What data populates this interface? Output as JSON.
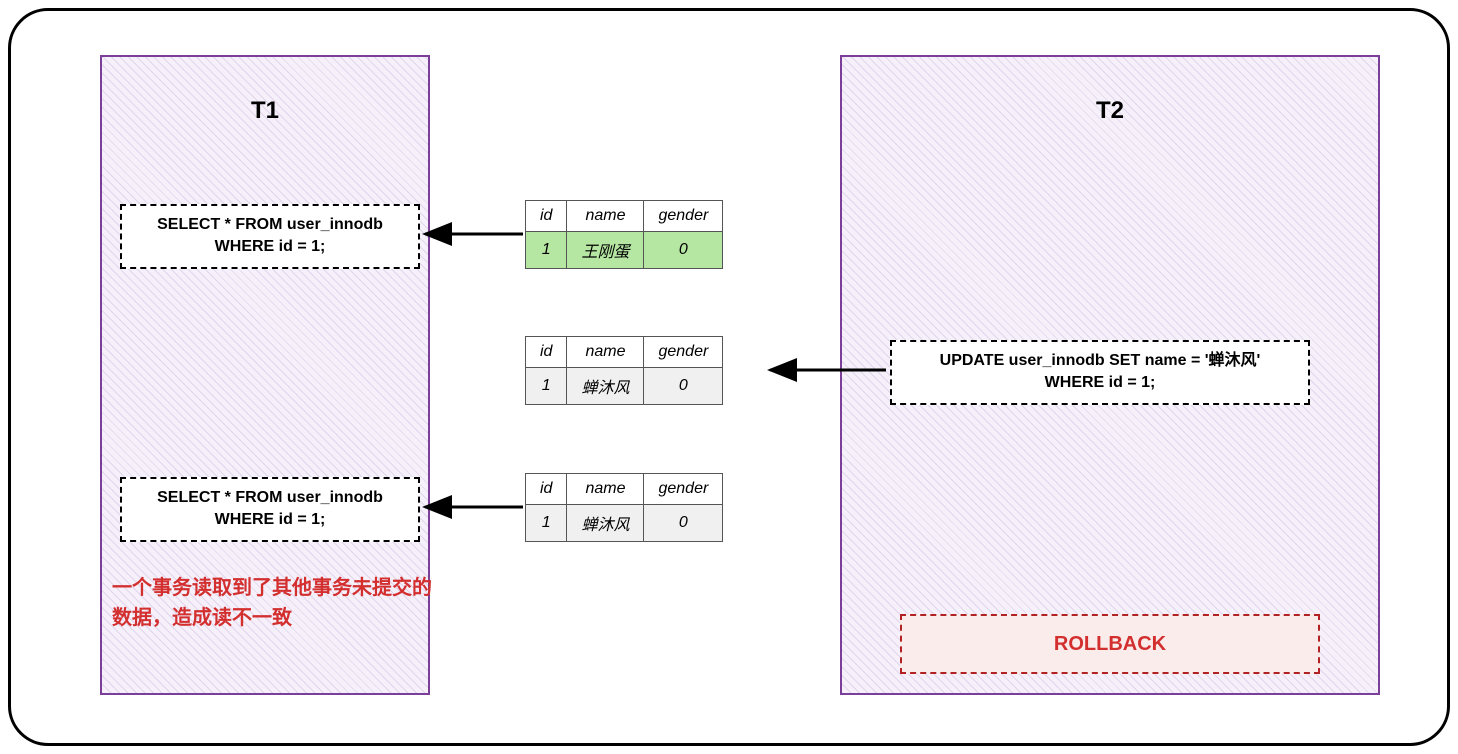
{
  "transactions": {
    "t1": {
      "title": "T1"
    },
    "t2": {
      "title": "T2"
    }
  },
  "sql": {
    "select1_line1": "SELECT * FROM user_innodb",
    "select1_line2": "WHERE id = 1;",
    "update_line1": "UPDATE user_innodb SET name = '蝉沐风'",
    "update_line2": "WHERE id = 1;",
    "select2_line1": "SELECT * FROM user_innodb",
    "select2_line2": "WHERE id = 1;",
    "rollback": "ROLLBACK"
  },
  "table": {
    "headers": {
      "id": "id",
      "name": "name",
      "gender": "gender"
    },
    "row1": {
      "id": "1",
      "name": "王刚蛋",
      "gender": "0"
    },
    "row2": {
      "id": "1",
      "name": "蝉沐风",
      "gender": "0"
    },
    "row3": {
      "id": "1",
      "name": "蝉沐风",
      "gender": "0"
    }
  },
  "note": "一个事务读取到了其他事务未提交的数据，造成读不一致"
}
